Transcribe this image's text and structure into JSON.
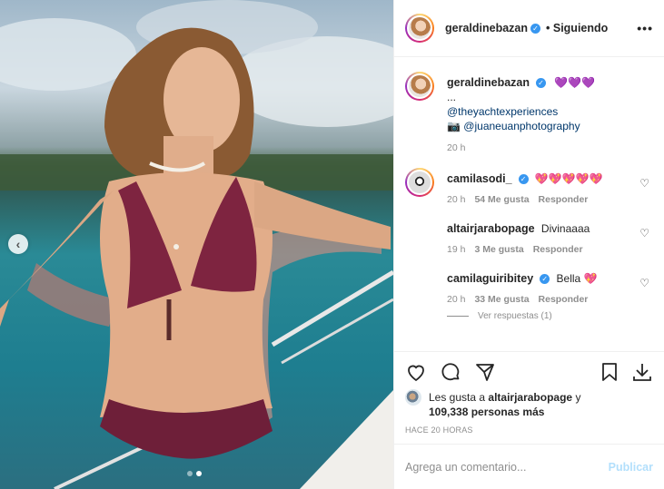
{
  "post": {
    "author": "geraldinebazan",
    "follow_status": "Siguiendo",
    "more_label": "•••"
  },
  "caption": {
    "user": "geraldinebazan",
    "hearts": "💜💜💜",
    "ellipsis": "...",
    "mention_1": "@theyachtexperiences",
    "camera_glyph": "📷",
    "mention_2": "@juaneuanphotography",
    "time": "20 h"
  },
  "comments": [
    {
      "user": "camilasodi_",
      "text": "💖💖💖💖💖",
      "time": "20 h",
      "likes": "54 Me gusta",
      "reply": "Responder"
    },
    {
      "user": "altairjarabopage",
      "text": "Divinaaaa",
      "time": "19 h",
      "likes": "3 Me gusta",
      "reply": "Responder"
    },
    {
      "user": "camilaguiribitey",
      "text": "Bella 💖",
      "time": "20 h",
      "likes": "33 Me gusta",
      "reply": "Responder"
    }
  ],
  "view_replies": "Ver respuestas (1)",
  "likes": {
    "prefix": "Les gusta a",
    "user": "altairjarabopage",
    "and": "y",
    "count": "109,338 personas más"
  },
  "timestamp": "HACE 20 HORAS",
  "composer": {
    "placeholder": "Agrega un comentario...",
    "publish": "Publicar"
  },
  "carousel": {
    "current": 2,
    "total": 2
  },
  "colors": {
    "verified": "#3897f0",
    "link": "#00376b",
    "publish_disabled": "#b2dffc",
    "muted": "#8e8e8e"
  },
  "icons": [
    "chevron-left-icon",
    "heart-icon",
    "comment-icon",
    "share-icon",
    "bookmark-icon",
    "download-icon",
    "verified-icon",
    "more-icon"
  ]
}
